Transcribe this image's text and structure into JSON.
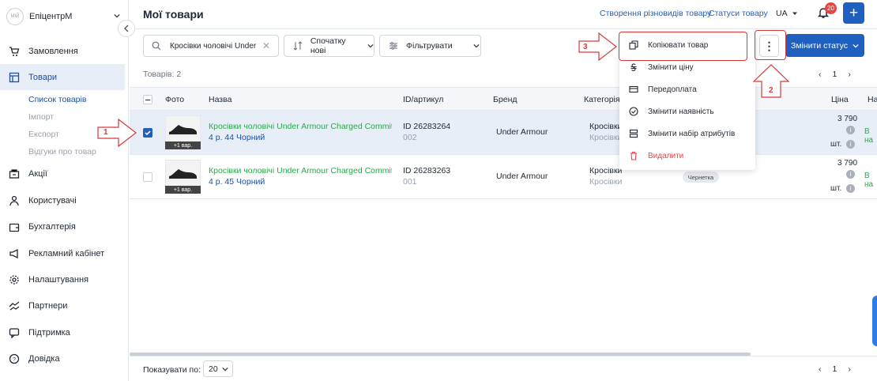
{
  "sidebar": {
    "brand": "ЕпіцентрМ",
    "logo_text": "МІЙ",
    "items": [
      {
        "label": "Замовлення"
      },
      {
        "label": "Товари"
      },
      {
        "label": "Акції"
      },
      {
        "label": "Користувачі"
      },
      {
        "label": "Бухгалтерія"
      },
      {
        "label": "Рекламний кабінет"
      },
      {
        "label": "Налаштування"
      },
      {
        "label": "Партнери"
      },
      {
        "label": "Підтримка"
      },
      {
        "label": "Довідка"
      }
    ],
    "subitems": [
      {
        "label": "Список товарів"
      },
      {
        "label": "Імпорт"
      },
      {
        "label": "Експорт"
      },
      {
        "label": "Відгуки про товар"
      }
    ]
  },
  "header": {
    "title": "Мої товари",
    "link1": "Створення різновидів товару",
    "link2": "Статуси товару",
    "lang": "UA",
    "notifications": "20",
    "add": "+"
  },
  "toolbar": {
    "search_value": "Кросівки чоловічі Under Armour",
    "sort_label": "Спочатку нові",
    "filter_label": "Фільтрувати",
    "more": "⋮",
    "status_label": "Змінити статус"
  },
  "list": {
    "count": "Товарів: 2",
    "page": "1"
  },
  "table": {
    "headers": {
      "photo": "Фото",
      "name": "Назва",
      "id": "ID/артикул",
      "brand": "Бренд",
      "category": "Категорія",
      "price": "Ціна",
      "avail": "На"
    },
    "rows": [
      {
        "badge": "+1 вар.",
        "name": "Кросівки чоловічі Under Armour Charged Commit Tr",
        "name2": "4 р. 44 Чорний",
        "id": "ID 26283264",
        "sku": "002",
        "brand": "Under Armour",
        "cat": "Кросівки",
        "cat2": "Кросівки",
        "price": "3 790",
        "unit": "шт.",
        "avail": "В на"
      },
      {
        "badge": "+1 вар.",
        "name": "Кросівки чоловічі Under Armour Charged Commit Tr",
        "name2": "4 р. 45 Чорний",
        "id": "ID 26283263",
        "sku": "001",
        "brand": "Under Armour",
        "cat": "Кросівки",
        "cat2": "Кросівки",
        "price": "3 790",
        "unit": "шт.",
        "avail": "В на",
        "status": "Чернетка"
      }
    ]
  },
  "menu": {
    "items": [
      {
        "label": "Копіювати товар"
      },
      {
        "label": "Змінити ціну"
      },
      {
        "label": "Передоплата"
      },
      {
        "label": "Змінити наявність"
      },
      {
        "label": "Змінити набір атрибутів"
      },
      {
        "label": "Видалити"
      }
    ]
  },
  "footer": {
    "show_label": "Показувати по:",
    "show_value": "20",
    "page": "1"
  },
  "annotations": [
    "1",
    "2",
    "3"
  ],
  "colors": {
    "accent": "#1f5fbf",
    "green": "#2aa84a",
    "annotation": "#d43a3a"
  }
}
